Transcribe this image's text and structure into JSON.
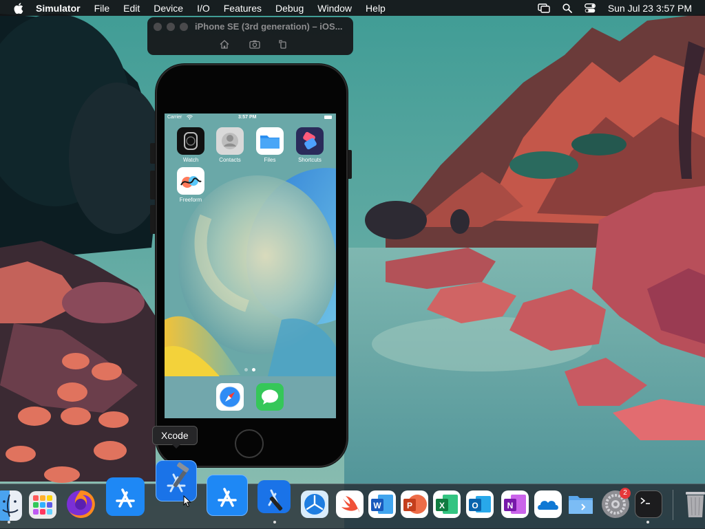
{
  "menubar": {
    "app_name": "Simulator",
    "items": [
      "File",
      "Edit",
      "Device",
      "I/O",
      "Features",
      "Debug",
      "Window",
      "Help"
    ],
    "clock": "Sun Jul 23  3:57 PM"
  },
  "simulator": {
    "title": "iPhone SE (3rd generation) – iOS..."
  },
  "phone": {
    "status": {
      "carrier": "Carrier",
      "time": "3:57 PM"
    },
    "apps": [
      {
        "label": "Watch",
        "icon": "watch-icon"
      },
      {
        "label": "Contacts",
        "icon": "contacts-icon"
      },
      {
        "label": "Files",
        "icon": "files-icon"
      },
      {
        "label": "Shortcuts",
        "icon": "shortcuts-icon"
      },
      {
        "label": "Freeform",
        "icon": "freeform-icon"
      }
    ],
    "page_count": 2,
    "current_page": 2,
    "dock_apps": [
      "safari-icon",
      "messages-icon"
    ]
  },
  "tooltip": "Xcode",
  "dock": {
    "apps": [
      "finder-icon",
      "launchpad-icon",
      "firefox-icon",
      "app-store-icon",
      "xcode-icon",
      "app-store-icon",
      "instruments-icon",
      "testflight-icon",
      "swift-icon",
      "word-icon",
      "powerpoint-icon",
      "excel-icon",
      "outlook-icon",
      "onenote-icon",
      "onedrive-icon",
      "files-folder-icon",
      "system-settings-icon",
      "terminal-icon",
      "trash-icon"
    ],
    "settings_badge": "2"
  },
  "colors": {
    "menubar": "#141416",
    "accent": "#1f7ae0"
  }
}
